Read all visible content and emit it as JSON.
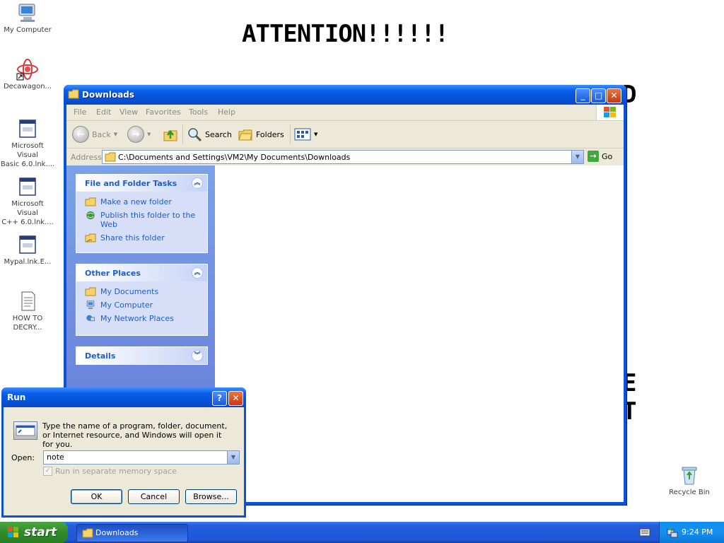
{
  "desktop": {
    "ransom_title": "ATTENTION!!!!!!",
    "ransom_fragments": [
      "D",
      "E",
      "T"
    ],
    "icons": [
      {
        "label": "My Computer"
      },
      {
        "label": "Decawagon..."
      },
      {
        "label": "Microsoft Visual\nBasic 6.0.lnk...."
      },
      {
        "label": "Microsoft Visual\nC++ 6.0.lnk...."
      },
      {
        "label": "Mypal.lnk.E..."
      },
      {
        "label": "HOW TO\nDECRY..."
      },
      {
        "label": "Recycle Bin"
      }
    ]
  },
  "explorer": {
    "title": "Downloads",
    "menu": [
      "File",
      "Edit",
      "View",
      "Favorites",
      "Tools",
      "Help"
    ],
    "toolbar": {
      "back": "Back",
      "search": "Search",
      "folders": "Folders"
    },
    "address": {
      "label": "Address",
      "path": "C:\\Documents and Settings\\VM2\\My Documents\\Downloads",
      "go": "Go"
    },
    "tasks": {
      "file_folder": {
        "title": "File and Folder Tasks",
        "items": [
          "Make a new folder",
          "Publish this folder to the Web",
          "Share this folder"
        ]
      },
      "other_places": {
        "title": "Other Places",
        "items": [
          "My Documents",
          "My Computer",
          "My Network Places"
        ]
      },
      "details": {
        "title": "Details"
      }
    }
  },
  "run_dialog": {
    "title": "Run",
    "description": "Type the name of a program, folder, document, or Internet resource, and Windows will open it for you.",
    "open_label": "Open:",
    "open_value": "note",
    "checkbox_label": "Run in separate memory space",
    "buttons": {
      "ok": "OK",
      "cancel": "Cancel",
      "browse": "Browse..."
    }
  },
  "taskbar": {
    "start_label": "start",
    "tasks": [
      {
        "label": "Downloads"
      }
    ],
    "clock": "9:24 PM"
  }
}
